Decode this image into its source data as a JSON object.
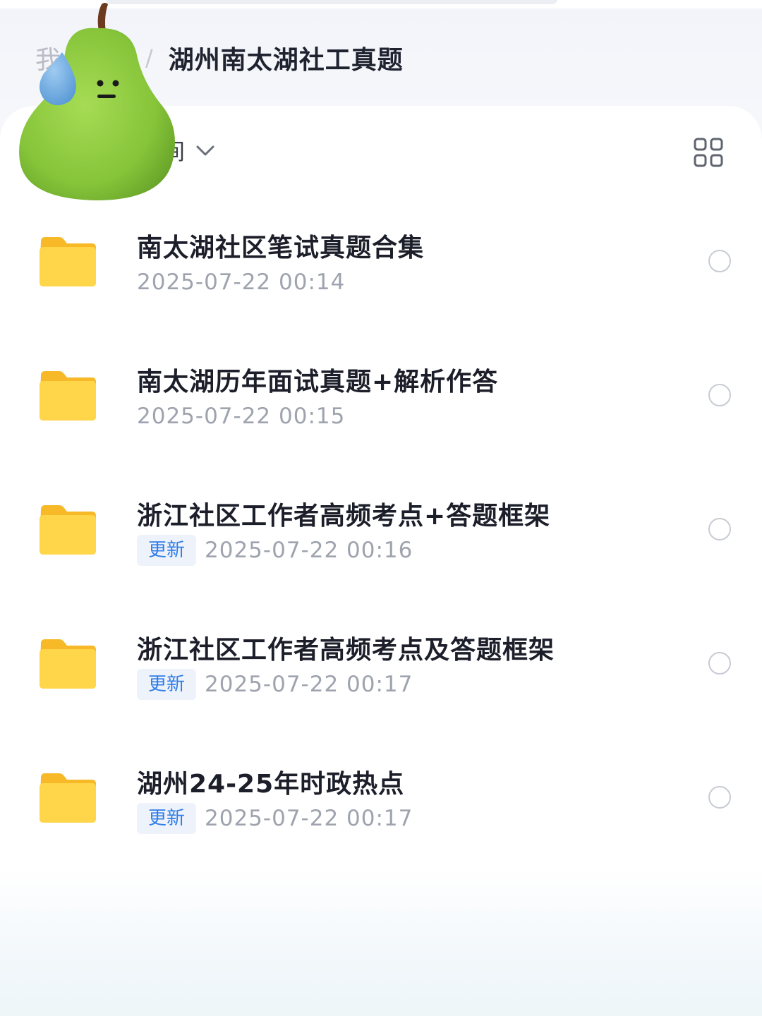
{
  "breadcrumb": {
    "root": "我",
    "separator": "/",
    "current": "湖州南太湖社工真题"
  },
  "toolbar": {
    "sort_label": "间",
    "sort_icon": "chevron-down-icon",
    "view_icon": "grid-view-icon"
  },
  "files": [
    {
      "name": "南太湖社区笔试真题合集",
      "date": "2025-07-22 00:14",
      "badge": ""
    },
    {
      "name": "南太湖历年面试真题+解析作答",
      "date": "2025-07-22 00:15",
      "badge": ""
    },
    {
      "name": "浙江社区工作者高频考点+答题框架",
      "date": "2025-07-22 00:16",
      "badge": "更新"
    },
    {
      "name": "浙江社区工作者高频考点及答题框架",
      "date": "2025-07-22 00:17",
      "badge": "更新"
    },
    {
      "name": "湖州24-25年时政热点",
      "date": "2025-07-22 00:17",
      "badge": "更新"
    }
  ],
  "colors": {
    "folder": "#ffcc33",
    "badge_text": "#2f7ce6",
    "pear": "#8cc63f"
  }
}
